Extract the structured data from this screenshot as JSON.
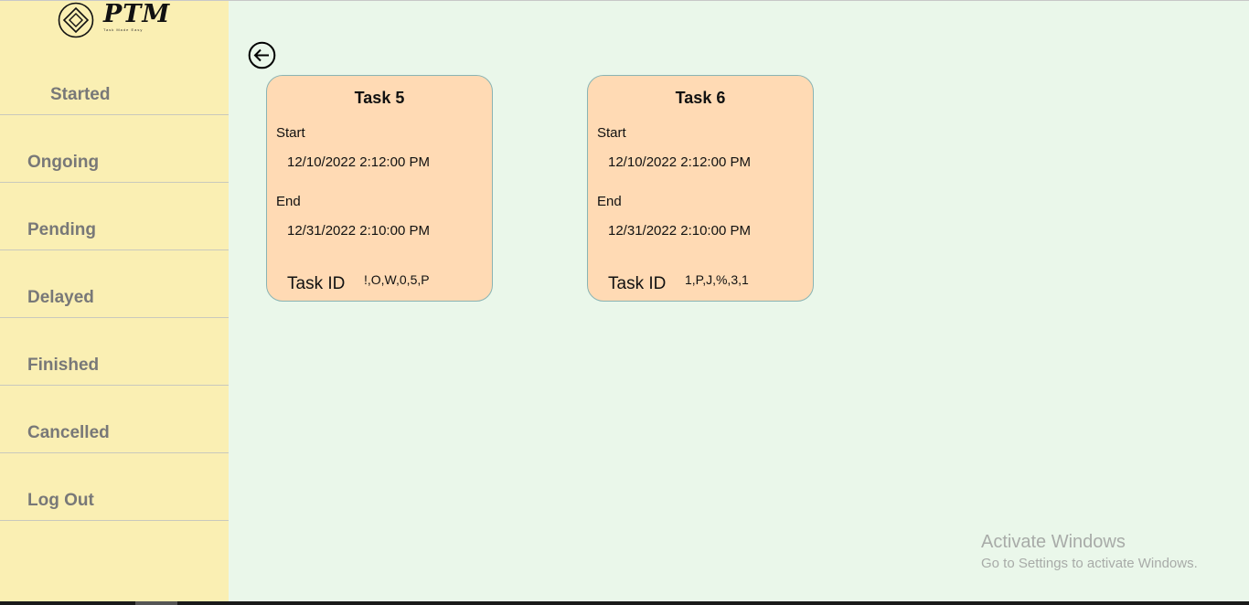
{
  "app": {
    "logo_text": "PTM",
    "logo_tagline": "Task Made Easy"
  },
  "sidebar": {
    "items": [
      {
        "label": "Started"
      },
      {
        "label": "Ongoing"
      },
      {
        "label": "Pending"
      },
      {
        "label": "Delayed"
      },
      {
        "label": "Finished"
      },
      {
        "label": "Cancelled"
      },
      {
        "label": "Log Out"
      }
    ]
  },
  "main": {
    "back_icon": "back-arrow-circle-icon",
    "cards": [
      {
        "title": "Task 5",
        "start_label": "Start",
        "start_value": "12/10/2022 2:12:00 PM",
        "end_label": "End",
        "end_value": "12/31/2022 2:10:00 PM",
        "id_label": "Task ID",
        "id_value": "!,O,W,0,5,P"
      },
      {
        "title": "Task 6",
        "start_label": "Start",
        "start_value": "12/10/2022 2:12:00 PM",
        "end_label": "End",
        "end_value": "12/31/2022 2:10:00 PM",
        "id_label": "Task ID",
        "id_value": "1,P,J,%,3,1"
      }
    ]
  },
  "watermark": {
    "title": "Activate Windows",
    "subtitle": "Go to Settings to activate Windows."
  },
  "colors": {
    "sidebar_bg": "#faefb3",
    "main_bg": "#eaf7ea",
    "card_bg": "#ffdab4",
    "nav_text": "#787878"
  }
}
